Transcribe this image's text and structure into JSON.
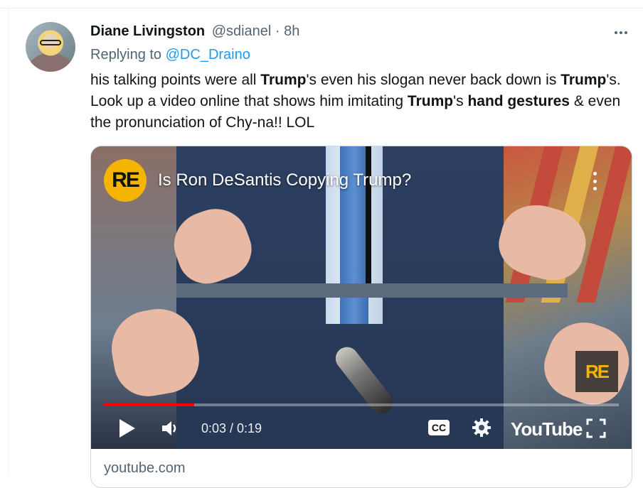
{
  "tweet": {
    "author_name": "Diane Livingston",
    "handle_time": "@sdianel · 8h",
    "replying_prefix": "Replying to ",
    "replying_to": "@DC_Draino",
    "text_parts": {
      "p1": "his talking points were all ",
      "b1": "Trump",
      "p2": "'s  even his slogan never back down is ",
      "b2": "Trump",
      "p3": "'s.  Look up a video online that shows him imitating ",
      "b3": "Trump",
      "p4": "'s ",
      "b4": "hand gestures",
      "p5": " & even the pronunciation of Chy-na!! LOL"
    }
  },
  "video": {
    "channel_badge": "RE",
    "title": "Is Ron DeSantis Copying Trump?",
    "watermark": "RE",
    "current_time": "0:03",
    "duration": "0:19",
    "time_display": "0:03 / 0:19",
    "progress_fraction": 0.175,
    "cc_label": "CC",
    "brand": "YouTube"
  },
  "card": {
    "domain": "youtube.com"
  },
  "colors": {
    "link": "#1d9bf0",
    "muted": "#536471",
    "progress": "#ff0000",
    "badge": "#f5b400"
  },
  "icons": [
    "more-icon",
    "kebab-icon",
    "play-icon",
    "volume-icon",
    "cc-icon",
    "gear-icon",
    "fullscreen-icon"
  ]
}
